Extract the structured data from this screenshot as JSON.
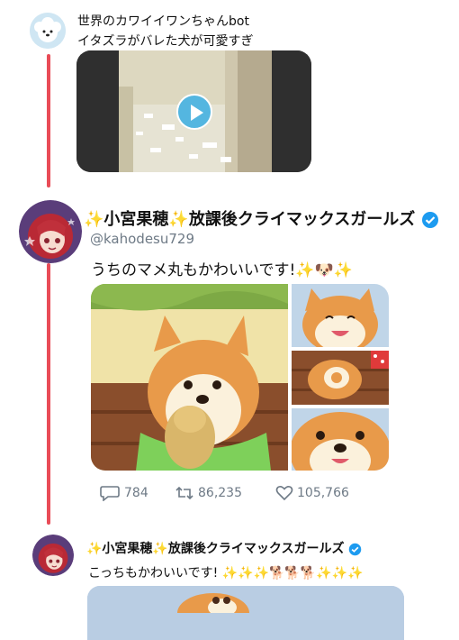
{
  "tweet1": {
    "name": "世界のカワイイワンちゃんbot",
    "text": "イタズラがバレた犬が可愛すぎ"
  },
  "tweet2": {
    "name": "✨小宮果穂✨放課後クライマックスガールズ",
    "handle": "@kahodesu729",
    "text": "うちのマメ丸もかわいいです!✨🐶✨",
    "replies": "784",
    "retweets": "86,235",
    "likes": "105,766"
  },
  "tweet3": {
    "name": "✨小宮果穂✨放課後クライマックスガールズ",
    "text": "こっちもかわいいです! ✨✨✨🐕🐕🐕✨✨✨"
  },
  "icons": [
    "play-icon",
    "reply-icon",
    "retweet-icon",
    "like-icon",
    "verified-icon"
  ],
  "colors": {
    "thread_line": "#e94c57",
    "verified": "#1d9bf0",
    "stat_gray": "#6e7a86"
  }
}
